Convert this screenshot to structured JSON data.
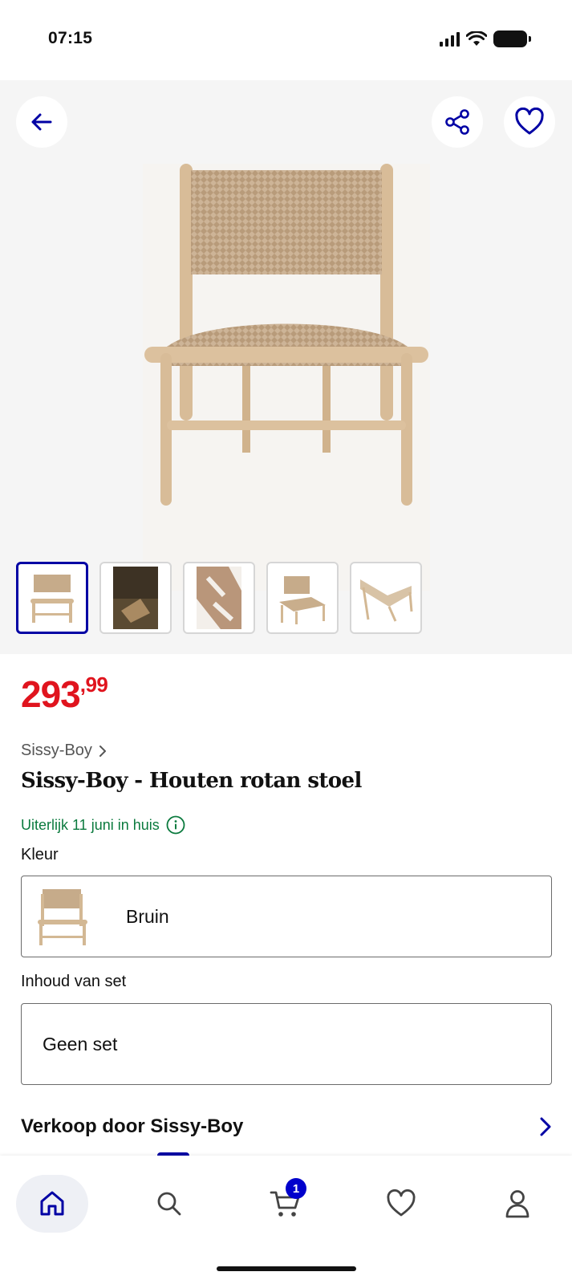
{
  "status_bar": {
    "time": "07:15"
  },
  "gallery": {
    "thumbnail_count": 5,
    "selected_thumbnail": 1
  },
  "product": {
    "price_int": "293",
    "price_dec": ",99",
    "brand": "Sissy-Boy",
    "title": "Sissy-Boy - Houten rotan stoel",
    "delivery": "Uiterlijk 11 juni in huis"
  },
  "options": {
    "color_label": "Kleur",
    "color_value": "Bruin",
    "set_label": "Inhoud van set",
    "set_value": "Geen set"
  },
  "seller": {
    "text": "Verkoop door Sissy-Boy"
  },
  "tab_bar": {
    "cart_count": "1"
  },
  "colors": {
    "accent_blue": "#0000a4",
    "price_red": "#e0141e",
    "delivery_green": "#0b7a3e"
  }
}
